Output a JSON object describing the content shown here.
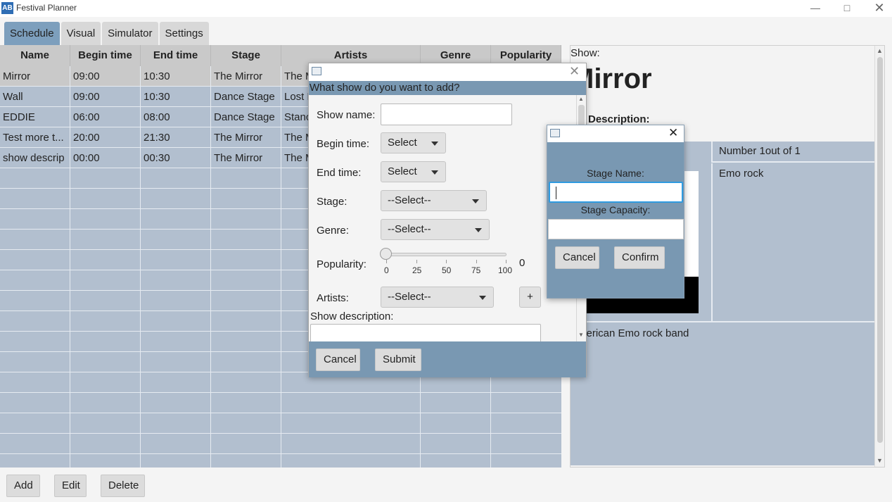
{
  "window": {
    "title": "Festival Planner",
    "icon_text": "AB"
  },
  "tabs": [
    {
      "label": "Schedule",
      "active": true
    },
    {
      "label": "Visual",
      "active": false
    },
    {
      "label": "Simulator",
      "active": false
    },
    {
      "label": "Settings",
      "active": false
    }
  ],
  "table": {
    "columns": [
      "Name",
      "Begin time",
      "End time",
      "Stage",
      "Artists",
      "Genre",
      "Popularity"
    ],
    "rows": [
      [
        "Mirror",
        "09:00",
        "10:30",
        "The Mirror",
        "The M",
        "",
        ""
      ],
      [
        "Wall",
        "09:00",
        "10:30",
        "Dance Stage",
        "Lost F",
        "",
        ""
      ],
      [
        "EDDIE",
        "06:00",
        "08:00",
        "Dance Stage",
        "Stanc",
        "",
        ""
      ],
      [
        "Test more t...",
        "20:00",
        "21:30",
        "The Mirror",
        "The M",
        "",
        ""
      ],
      [
        "show descrip",
        "00:00",
        "00:30",
        "The Mirror",
        "The M",
        "",
        ""
      ]
    ]
  },
  "detail": {
    "show_label": "Show:",
    "show_title": "Mirror",
    "description_label": "ow Description:",
    "stage_count": "Number 1out of 1",
    "genre": "Emo rock",
    "description": "merican Emo rock band"
  },
  "bottom_buttons": {
    "add": "Add",
    "edit": "Edit",
    "delete": "Delete"
  },
  "add_show_dialog": {
    "header": "What show do you want to add?",
    "show_name_label": "Show name:",
    "show_name_value": "",
    "begin_time_label": "Begin time:",
    "begin_time_value": "Select",
    "end_time_label": "End time:",
    "end_time_value": "Select",
    "stage_label": "Stage:",
    "stage_value": "--Select--",
    "genre_label": "Genre:",
    "genre_value": "--Select--",
    "popularity_label": "Popularity:",
    "popularity_value": "0",
    "popularity_fraction": 0,
    "slider_ticks": [
      "0",
      "25",
      "50",
      "75",
      "100"
    ],
    "artists_label": "Artists:",
    "artists_value": "--Select--",
    "add_artist": "+",
    "description_label": "Show description:",
    "cancel": "Cancel",
    "submit": "Submit"
  },
  "stage_dialog": {
    "name_label": "Stage Name:",
    "name_value": "",
    "capacity_label": "Stage Capacity:",
    "capacity_value": "",
    "cancel": "Cancel",
    "confirm": "Confirm"
  }
}
